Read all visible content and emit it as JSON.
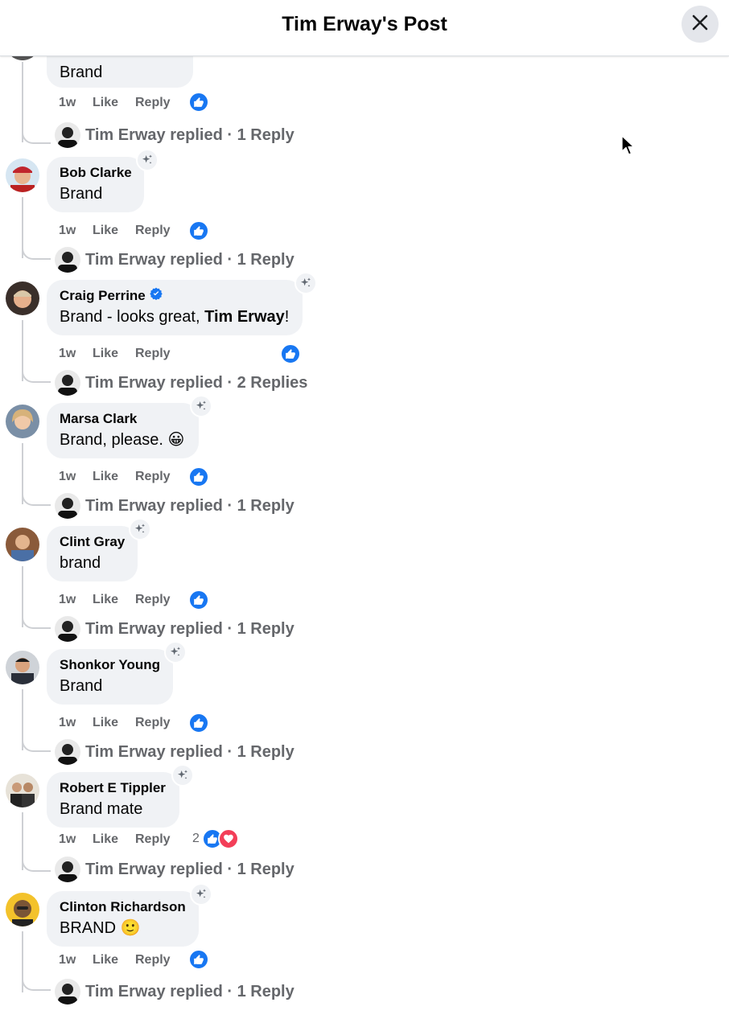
{
  "header": {
    "title": "Tim Erway's Post"
  },
  "comments": [
    {
      "author": "",
      "text": "Brand",
      "time": "1w",
      "like_label": "Like",
      "reply_label": "Reply",
      "reaction_count": "",
      "replies_text": "Tim Erway replied · 1 Reply"
    },
    {
      "author": "Bob Clarke",
      "text": "Brand",
      "time": "1w",
      "like_label": "Like",
      "reply_label": "Reply",
      "reaction_count": "",
      "replies_text": "Tim Erway replied · 1 Reply"
    },
    {
      "author": "Craig Perrine",
      "text_prefix": "Brand - looks great, ",
      "mention": "Tim Erway",
      "text_suffix": "!",
      "verified": true,
      "time": "1w",
      "like_label": "Like",
      "reply_label": "Reply",
      "reaction_count": "",
      "replies_text": "Tim Erway replied · 2 Replies"
    },
    {
      "author": "Marsa Clark",
      "text": "Brand, please. 😀",
      "time": "1w",
      "like_label": "Like",
      "reply_label": "Reply",
      "reaction_count": "",
      "replies_text": "Tim Erway replied · 1 Reply"
    },
    {
      "author": "Clint Gray",
      "text": "brand",
      "time": "1w",
      "like_label": "Like",
      "reply_label": "Reply",
      "reaction_count": "",
      "replies_text": "Tim Erway replied · 1 Reply"
    },
    {
      "author": "Shonkor Young",
      "text": "Brand",
      "time": "1w",
      "like_label": "Like",
      "reply_label": "Reply",
      "reaction_count": "",
      "replies_text": "Tim Erway replied · 1 Reply"
    },
    {
      "author": "Robert E Tippler",
      "text": "Brand mate",
      "time": "1w",
      "like_label": "Like",
      "reply_label": "Reply",
      "reaction_count": "2",
      "replies_text": "Tim Erway replied · 1 Reply"
    },
    {
      "author": "Clinton Richardson",
      "text": "BRAND 🙂",
      "time": "1w",
      "like_label": "Like",
      "reply_label": "Reply",
      "reaction_count": "",
      "replies_text": "Tim Erway replied · 1 Reply"
    }
  ],
  "icons": {
    "close": "close-icon",
    "ai_sparkle": "sparkle-icon",
    "verified": "verified-badge-icon",
    "like_reaction": "like-reaction-icon",
    "love_reaction": "love-reaction-icon",
    "cursor": "mouse-cursor-icon"
  },
  "colors": {
    "bubble": "#f0f2f5",
    "secondary_text": "#65676b",
    "like_blue": "#1877f2",
    "love_red": "#f33e58"
  }
}
